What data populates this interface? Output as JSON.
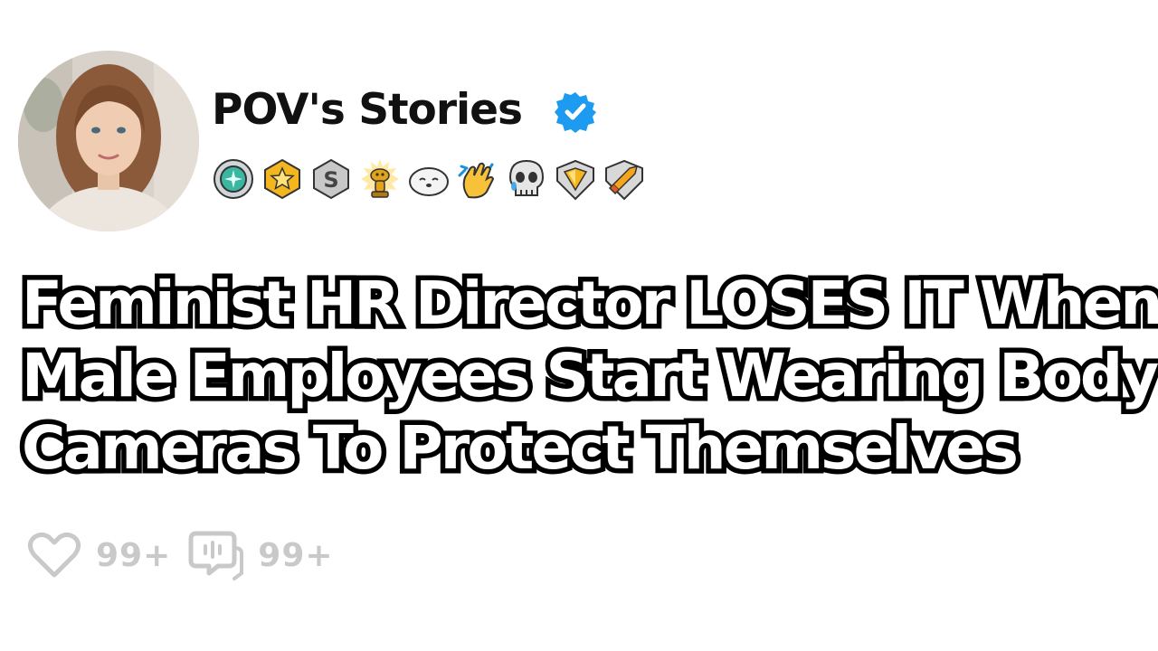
{
  "post": {
    "author": {
      "name": "POV's Stories",
      "verified_icon": "verified-badge-icon",
      "accent_color": "#1d9bf0"
    },
    "awards": [
      "helpful-award-icon",
      "gold-star-award-icon",
      "silver-award-icon",
      "golden-snoo-award-icon",
      "wholesome-seal-award-icon",
      "clap-award-icon",
      "skull-laughing-award-icon",
      "gold-gem-award-icon",
      "platinum-rocket-award-icon"
    ],
    "title_lines": [
      "Feminist HR Director LOSES IT When",
      "Male Employees Start Wearing Body",
      "Cameras To Protect Themselves"
    ],
    "stats": {
      "likes": "99+",
      "comments": "99+",
      "like_icon": "heart-icon",
      "comment_icon": "comment-icon",
      "color": "#c9c9c9"
    }
  }
}
